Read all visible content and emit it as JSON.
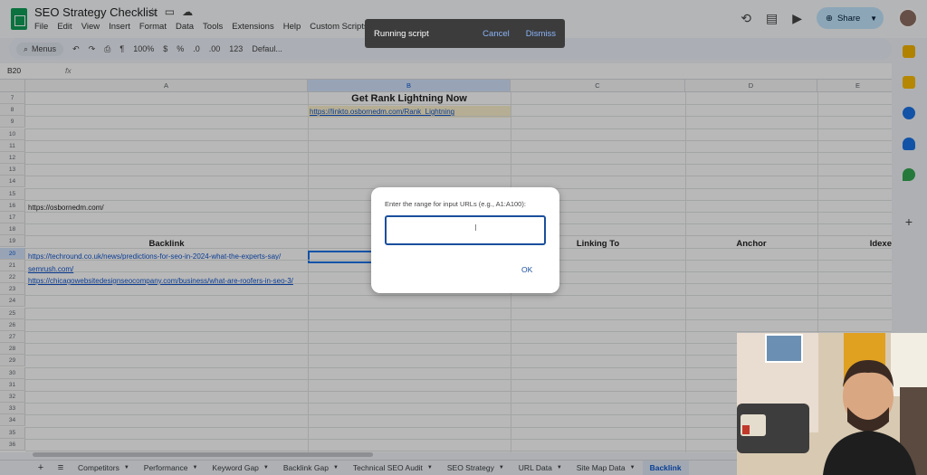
{
  "doc": {
    "title": "SEO Strategy Checklist",
    "menus": [
      "File",
      "Edit",
      "View",
      "Insert",
      "Format",
      "Data",
      "Tools",
      "Extensions",
      "Help",
      "Custom Scripts"
    ]
  },
  "share_label": "Share",
  "toast": {
    "message": "Running script",
    "cancel": "Cancel",
    "dismiss": "Dismiss"
  },
  "toolbar": {
    "menus_label": "Menus",
    "zoom": "100%",
    "currency": "$",
    "percent": "%",
    "dec_less": ".0",
    "dec_more": ".00",
    "number_format": "123",
    "font": "Defaul..."
  },
  "formula_bar": {
    "cell_ref": "B20",
    "fx": "fx"
  },
  "columns": [
    "A",
    "B",
    "C",
    "D",
    "E"
  ],
  "rows": [
    "7",
    "8",
    "9",
    "10",
    "11",
    "12",
    "13",
    "14",
    "15",
    "16",
    "17",
    "18",
    "19",
    "20",
    "21",
    "22",
    "23",
    "24",
    "25",
    "26",
    "27",
    "28",
    "29",
    "30",
    "31",
    "32",
    "33",
    "34",
    "35",
    "36"
  ],
  "cells": {
    "title": "Get Rank Lightning Now",
    "title_link": "https://linkto.osbornedm.com/Rank_Lightning",
    "site_url": "https://osbornedm.com/",
    "header_backlink": "Backlink",
    "header_linking_to": "Linking To",
    "header_anchor": "Anchor",
    "header_indexed": "Idexe",
    "backlinks": [
      "https://techround.co.uk/news/predictions-for-seo-in-2024-what-the-experts-say/",
      "semrush.com/",
      "https://chicagowebsitedesignseocompany.com/business/what-are-roofers-in-seo-3/"
    ]
  },
  "dialog": {
    "prompt": "Enter the range for input URLs (e.g., A1:A100):",
    "input_value": "",
    "ok_label": "OK"
  },
  "sheet_tabs": [
    "Competitors",
    "Performance",
    "Keyword Gap",
    "Backlink Gap",
    "Technical SEO Audit",
    "SEO Strategy",
    "URL Data",
    "Site Map Data",
    "Backlink"
  ],
  "active_tab": "Backlink",
  "colors": {
    "accent": "#1a73e8",
    "share_bg": "#c2e7ff",
    "sheets_green": "#0f9d58",
    "link": "#1155cc"
  }
}
